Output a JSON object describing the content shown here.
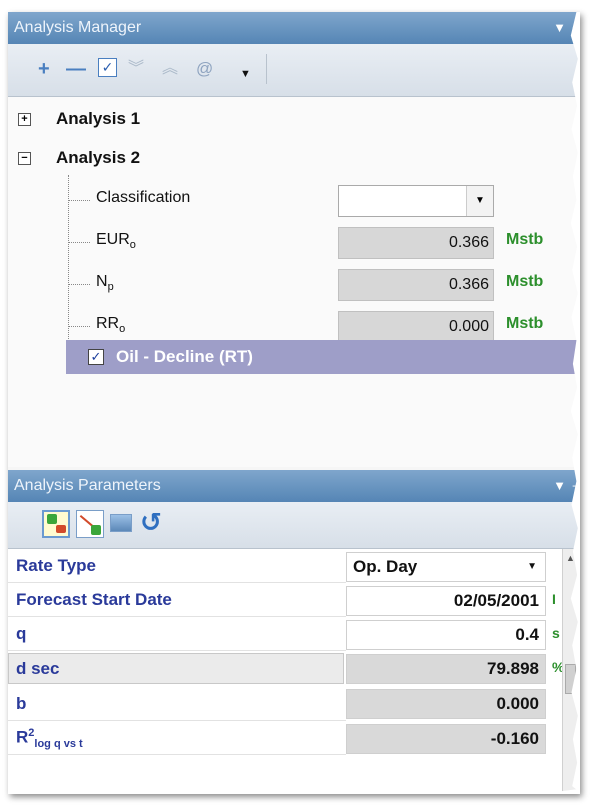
{
  "analysis_manager": {
    "title": "Analysis Manager",
    "tree": {
      "analysis1": "Analysis 1",
      "analysis2": "Analysis 2",
      "properties": [
        {
          "label": "Classification",
          "value": "",
          "unit": ""
        },
        {
          "label": "EUR",
          "sub": "o",
          "value": "0.366",
          "unit": "Mstb"
        },
        {
          "label": "N",
          "sub": "p",
          "value": "0.366",
          "unit": "Mstb"
        },
        {
          "label": "RR",
          "sub": "o",
          "value": "0.000",
          "unit": "Mstb"
        }
      ],
      "selected_item": "Oil - Decline (RT)"
    }
  },
  "analysis_parameters": {
    "title": "Analysis Parameters",
    "rows": [
      {
        "label": "Rate Type",
        "value": "Op. Day"
      },
      {
        "label": "Forecast Start Date",
        "value": "02/05/2001"
      },
      {
        "label": "q",
        "value": "0.4"
      },
      {
        "label": "d sec",
        "value": "79.898"
      },
      {
        "label": "b",
        "value": "0.000"
      },
      {
        "label": "R",
        "sup": "2",
        "sub": "log q vs t",
        "value": "-0.160"
      }
    ]
  },
  "colors": {
    "header": "#6a93bf",
    "selection": "#9e9ec8",
    "unit_green": "#2c8f2c",
    "param_label_blue": "#2a3a9a"
  },
  "icons": [
    "plus-icon",
    "minus-icon",
    "check-icon",
    "expand-all-icon",
    "collapse-all-icon",
    "at-icon",
    "dropdown-arrow-icon",
    "pin-icon",
    "refresh-icon"
  ]
}
